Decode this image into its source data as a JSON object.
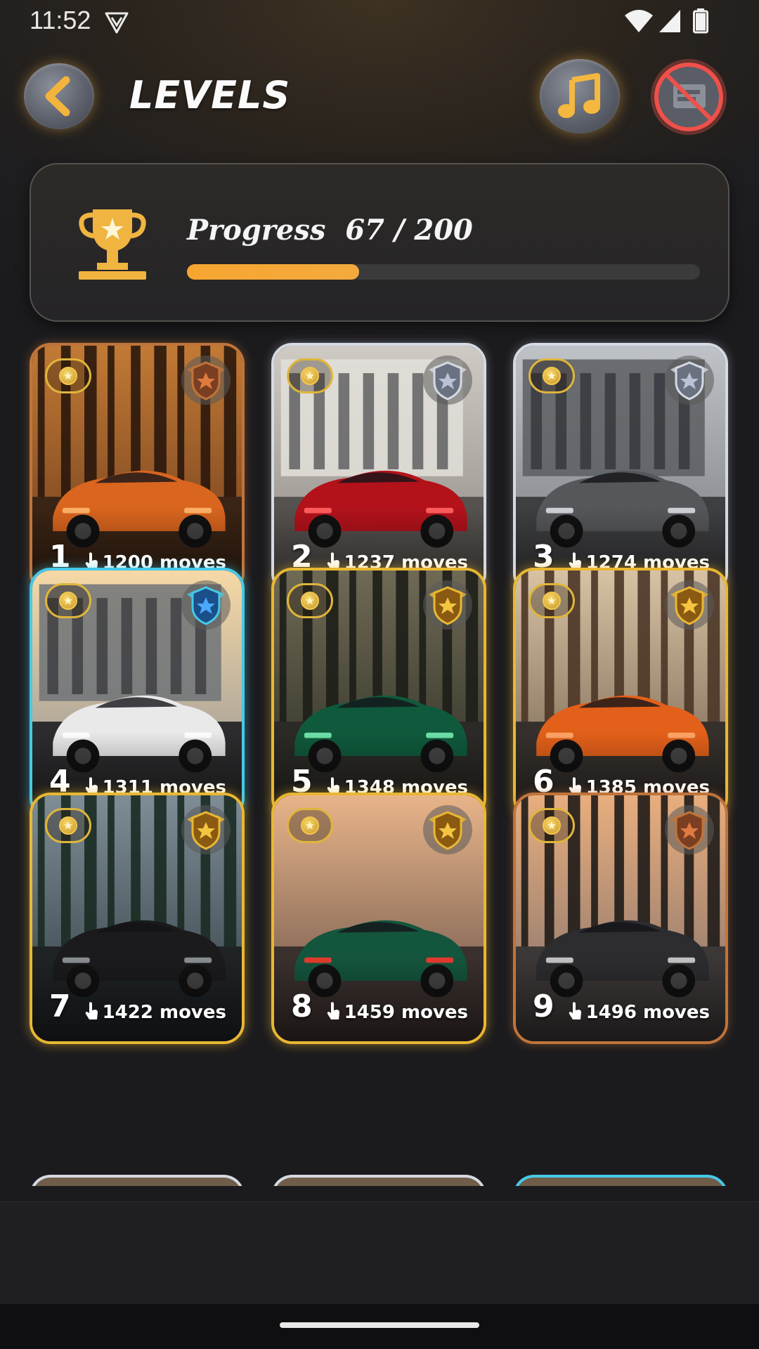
{
  "status_bar": {
    "time": "11:52"
  },
  "header": {
    "title": "LEVELS"
  },
  "progress": {
    "label": "Progress",
    "value_text": "67 / 200",
    "current": 67,
    "total": 200,
    "fraction": 0.335
  },
  "colors": {
    "accent_orange": "#f7a530",
    "tier_bronze": "#c0743a",
    "tier_silver": "#d5d9e3",
    "tier_diamond": "#47c9e6",
    "tier_gold": "#e9b733"
  },
  "levels": [
    {
      "number": "1",
      "moves": "1200 moves",
      "tier": "bronze",
      "scene": "orange-car-forest"
    },
    {
      "number": "2",
      "moves": "1237 moves",
      "tier": "silver",
      "scene": "red-car-building"
    },
    {
      "number": "3",
      "moves": "1274 moves",
      "tier": "silver",
      "scene": "grey-car-city"
    },
    {
      "number": "4",
      "moves": "1311 moves",
      "tier": "diamond",
      "scene": "white-car-sunset-building"
    },
    {
      "number": "5",
      "moves": "1348 moves",
      "tier": "gold",
      "scene": "green-car-forest"
    },
    {
      "number": "6",
      "moves": "1385 moves",
      "tier": "gold",
      "scene": "orange-car-road"
    },
    {
      "number": "7",
      "moves": "1422 moves",
      "tier": "gold",
      "scene": "black-car-lake"
    },
    {
      "number": "8",
      "moves": "1459 moves",
      "tier": "gold",
      "scene": "green-car-sunset"
    },
    {
      "number": "9",
      "moves": "1496 moves",
      "tier": "bronze",
      "scene": "dark-car-lake"
    }
  ],
  "icons": {
    "back": "chevron-left-icon",
    "music": "music-note-icon",
    "no_ads": "no-ads-icon",
    "trophy": "trophy-icon",
    "coin": "star-coin-icon",
    "moves": "finger-tap-icon"
  }
}
